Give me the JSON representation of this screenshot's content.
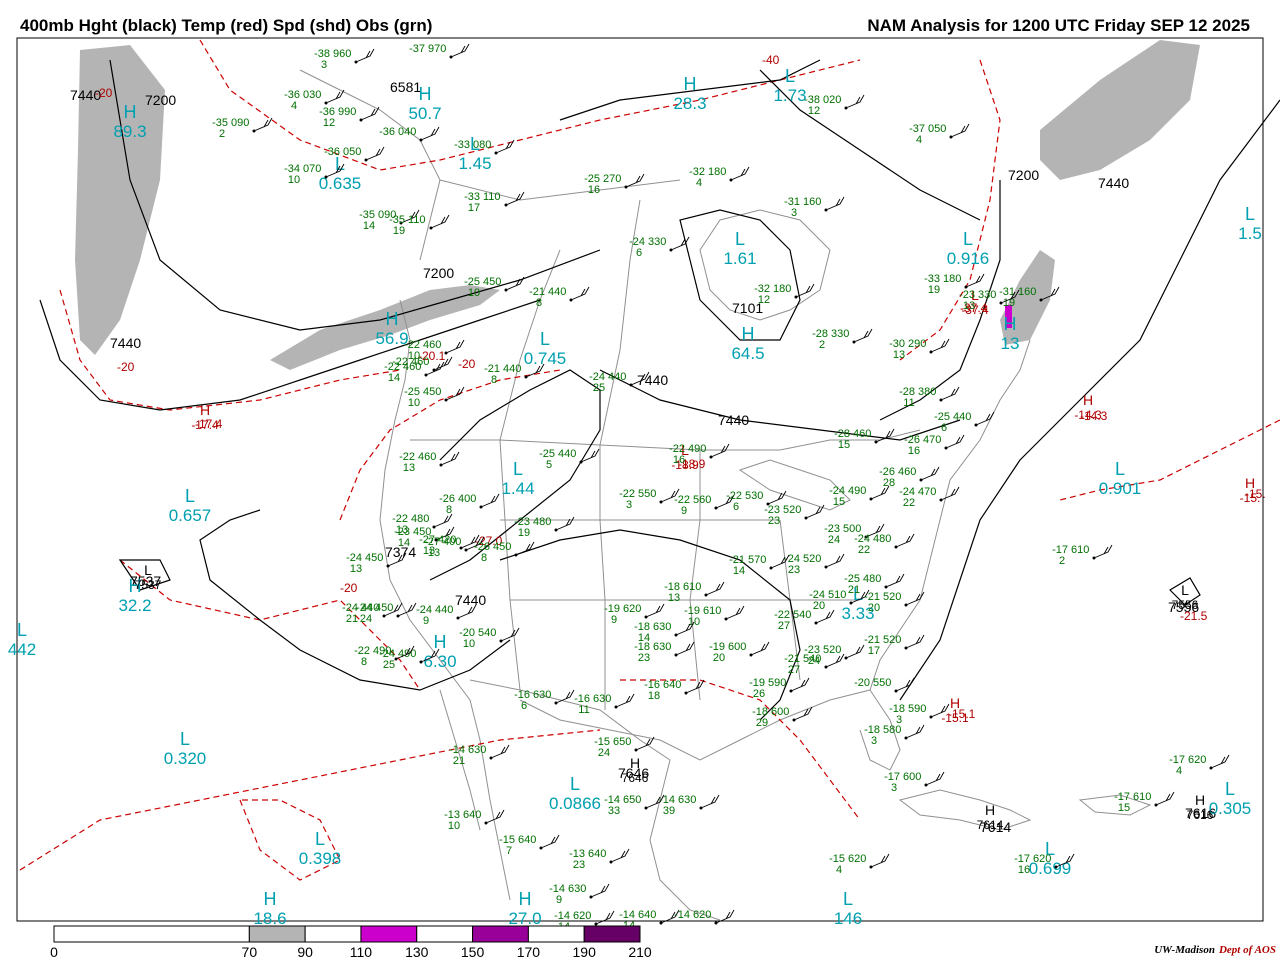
{
  "header": {
    "title_left": "400mb Hght (black) Temp (red) Spd (shd) Obs (grn)",
    "title_right": "NAM Analysis for 1200 UTC Friday  SEP 12 2025"
  },
  "footer": {
    "credit_university": "UW-Madison",
    "credit_dept": "Dept of AOS"
  },
  "colors": {
    "height_contour": "#000000",
    "temp_contour": "#cc0000",
    "obs": "#007000",
    "pressure_centers_low": "#00a0b0",
    "pressure_centers_temp": "#b00000",
    "map_outline": "#808080",
    "speed_70_90": "#b4b4b4",
    "speed_110_130": "#cc00cc",
    "speed_150_170": "#990099",
    "speed_190_210": "#660066"
  },
  "colorbar": {
    "labels": [
      "0",
      "70",
      "90",
      "110",
      "130",
      "150",
      "170",
      "190",
      "210"
    ],
    "bins": [
      {
        "from": 0,
        "to": 70,
        "color": "#ffffff"
      },
      {
        "from": 70,
        "to": 90,
        "color": "#b4b4b4"
      },
      {
        "from": 90,
        "to": 110,
        "color": "#ffffff"
      },
      {
        "from": 110,
        "to": 130,
        "color": "#cc00cc"
      },
      {
        "from": 130,
        "to": 150,
        "color": "#ffffff"
      },
      {
        "from": 150,
        "to": 170,
        "color": "#990099"
      },
      {
        "from": 170,
        "to": 190,
        "color": "#ffffff"
      },
      {
        "from": 190,
        "to": 210,
        "color": "#660066"
      }
    ]
  },
  "height_labels": [
    "7440",
    "7200",
    "7200",
    "7440",
    "7440",
    "7200",
    "7440",
    "7440",
    "7537",
    "7374",
    "7440",
    "6581",
    "7556",
    "7646",
    "7614",
    "7616",
    "7101"
  ],
  "temp_labels": [
    "-20",
    "-40",
    "-20",
    "-20",
    "-20",
    "-17.4",
    "-37.4",
    "-14.3",
    "-15.",
    "-18.9",
    "-15.1",
    "-21.5",
    "-20.1",
    "-27.0"
  ],
  "centers": [
    {
      "letter": "L",
      "value": "0.657",
      "kind": "low"
    },
    {
      "letter": "H",
      "value": "32.2",
      "kind": "low"
    },
    {
      "letter": "L",
      "value": "442",
      "kind": "low"
    },
    {
      "letter": "L",
      "value": "0.320",
      "kind": "low"
    },
    {
      "letter": "L",
      "value": "0.398",
      "kind": "low"
    },
    {
      "letter": "H",
      "value": "18.6",
      "kind": "low"
    },
    {
      "letter": "H",
      "value": "27.0",
      "kind": "low"
    },
    {
      "letter": "L",
      "value": "146",
      "kind": "low"
    },
    {
      "letter": "L",
      "value": "0.0866",
      "kind": "low"
    },
    {
      "letter": "L",
      "value": "1.44",
      "kind": "low"
    },
    {
      "letter": "L",
      "value": "0.745",
      "kind": "low"
    },
    {
      "letter": "H",
      "value": "89.3",
      "kind": "low"
    },
    {
      "letter": "L",
      "value": "0.635",
      "kind": "low"
    },
    {
      "letter": "H",
      "value": "50.7",
      "kind": "low"
    },
    {
      "letter": "L",
      "value": "1.45",
      "kind": "low"
    },
    {
      "letter": "H",
      "value": "28.3",
      "kind": "low"
    },
    {
      "letter": "L",
      "value": "1.73",
      "kind": "low"
    },
    {
      "letter": "L",
      "value": "1.61",
      "kind": "low"
    },
    {
      "letter": "H",
      "value": "64.5",
      "kind": "low"
    },
    {
      "letter": "L",
      "value": "0.916",
      "kind": "low"
    },
    {
      "letter": "L",
      "value": "0.901",
      "kind": "low"
    },
    {
      "letter": "L",
      "value": "0.305",
      "kind": "low"
    },
    {
      "letter": "H",
      "value": "6.30",
      "kind": "low"
    },
    {
      "letter": "L",
      "value": "3.33",
      "kind": "low"
    },
    {
      "letter": "L",
      "value": "0.699",
      "kind": "low"
    },
    {
      "letter": "H",
      "value": "56.9",
      "kind": "low"
    },
    {
      "letter": "H",
      "value": "13",
      "kind": "low"
    },
    {
      "letter": "L",
      "value": "1.5",
      "kind": "low"
    },
    {
      "letter": "H",
      "value": "-17.4",
      "kind": "temp"
    },
    {
      "letter": "L",
      "value": "-37.4",
      "kind": "temp"
    },
    {
      "letter": "H",
      "value": "-14.3",
      "kind": "temp"
    },
    {
      "letter": "H",
      "value": "-15.",
      "kind": "temp"
    },
    {
      "letter": "H",
      "value": "-15.1",
      "kind": "temp"
    },
    {
      "letter": "L",
      "value": "-18.9",
      "kind": "temp"
    },
    {
      "letter": "H",
      "value": "7646",
      "kind": "height"
    },
    {
      "letter": "H",
      "value": "7614",
      "kind": "height"
    },
    {
      "letter": "H",
      "value": "7616",
      "kind": "height"
    },
    {
      "letter": "L",
      "value": "7537",
      "kind": "height"
    },
    {
      "letter": "L",
      "value": "7556",
      "kind": "height"
    }
  ],
  "observations": [
    {
      "t": "-38",
      "h": "960",
      "d": "3"
    },
    {
      "t": "-37",
      "h": "970",
      "d": ""
    },
    {
      "t": "-36",
      "h": "030",
      "d": "4"
    },
    {
      "t": "-35",
      "h": "090",
      "d": "2"
    },
    {
      "t": "-36",
      "h": "990",
      "d": "12"
    },
    {
      "t": "-36",
      "h": "040",
      "d": ""
    },
    {
      "t": "-36",
      "h": "050",
      "d": ""
    },
    {
      "t": "-34",
      "h": "070",
      "d": "10"
    },
    {
      "t": "-33",
      "h": "080",
      "d": ""
    },
    {
      "t": "-33",
      "h": "110",
      "d": "17"
    },
    {
      "t": "-35",
      "h": "090",
      "d": "14"
    },
    {
      "t": "-35",
      "h": "110",
      "d": "19"
    },
    {
      "t": "-25",
      "h": "270",
      "d": "16"
    },
    {
      "t": "-32",
      "h": "180",
      "d": "4"
    },
    {
      "t": "-31",
      "h": "160",
      "d": "3"
    },
    {
      "t": "-38",
      "h": "020",
      "d": "12"
    },
    {
      "t": "-37",
      "h": "050",
      "d": "4"
    },
    {
      "t": "-24",
      "h": "330",
      "d": "6"
    },
    {
      "t": "-32",
      "h": "180",
      "d": "12"
    },
    {
      "t": "-31",
      "h": "160",
      "d": "19"
    },
    {
      "t": "-33",
      "h": "180",
      "d": "19"
    },
    {
      "t": "-23",
      "h": "330",
      "d": "13"
    },
    {
      "t": "-28",
      "h": "330",
      "d": "2"
    },
    {
      "t": "-30",
      "h": "290",
      "d": "13"
    },
    {
      "t": "-28",
      "h": "380",
      "d": "11"
    },
    {
      "t": "-25",
      "h": "440",
      "d": "6"
    },
    {
      "t": "-28",
      "h": "460",
      "d": "15"
    },
    {
      "t": "-26",
      "h": "470",
      "d": "16"
    },
    {
      "t": "-26",
      "h": "460",
      "d": "28"
    },
    {
      "t": "-24",
      "h": "470",
      "d": "22"
    },
    {
      "t": "-24",
      "h": "490",
      "d": "15"
    },
    {
      "t": "-23",
      "h": "500",
      "d": "24"
    },
    {
      "t": "-24",
      "h": "480",
      "d": "22"
    },
    {
      "t": "-25",
      "h": "480",
      "d": "21"
    },
    {
      "t": "-24",
      "h": "510",
      "d": "20"
    },
    {
      "t": "-21",
      "h": "520",
      "d": "20"
    },
    {
      "t": "-21",
      "h": "520",
      "d": "17"
    },
    {
      "t": "-23",
      "h": "520",
      "d": "24"
    },
    {
      "t": "-24",
      "h": "520",
      "d": "23"
    },
    {
      "t": "-20",
      "h": "550",
      "d": ""
    },
    {
      "t": "-18",
      "h": "590",
      "d": "3"
    },
    {
      "t": "-18",
      "h": "580",
      "d": "3"
    },
    {
      "t": "-17",
      "h": "600",
      "d": "3"
    },
    {
      "t": "-17",
      "h": "610",
      "d": "2"
    },
    {
      "t": "-17",
      "h": "620",
      "d": "4"
    },
    {
      "t": "-17",
      "h": "610",
      "d": "15"
    },
    {
      "t": "-17",
      "h": "620",
      "d": "16"
    },
    {
      "t": "-15",
      "h": "620",
      "d": "4"
    },
    {
      "t": "-21",
      "h": "440",
      "d": "8"
    },
    {
      "t": "-22",
      "h": "460",
      "d": "10"
    },
    {
      "t": "-22",
      "h": "460",
      "d": "14"
    },
    {
      "t": "-22",
      "h": "460",
      "d": "13"
    },
    {
      "t": "-23",
      "h": "450",
      "d": "14"
    },
    {
      "t": "-24",
      "h": "440",
      "d": "25"
    },
    {
      "t": "-25",
      "h": "450",
      "d": "10"
    },
    {
      "t": "-25",
      "h": "440",
      "d": "5"
    },
    {
      "t": "-24",
      "h": "450",
      "d": "13"
    },
    {
      "t": "-24",
      "h": "490",
      "d": "25"
    },
    {
      "t": "-22",
      "h": "480",
      "d": "13"
    },
    {
      "t": "-26",
      "h": "400",
      "d": "8"
    },
    {
      "t": "-27",
      "h": "400",
      "d": "13"
    },
    {
      "t": "-23",
      "h": "480",
      "d": "19"
    },
    {
      "t": "-24",
      "h": "440",
      "d": "21"
    },
    {
      "t": "-27",
      "h": "420",
      "d": "13"
    },
    {
      "t": "-26",
      "h": "450",
      "d": "8"
    },
    {
      "t": "-24",
      "h": "450",
      "d": "24"
    },
    {
      "t": "-24",
      "h": "440",
      "d": "9"
    },
    {
      "t": "-20",
      "h": "540",
      "d": "10"
    },
    {
      "t": "-22",
      "h": "490",
      "d": "8"
    },
    {
      "t": "-22",
      "h": "490",
      "d": "16"
    },
    {
      "t": "-22",
      "h": "550",
      "d": "3"
    },
    {
      "t": "-22",
      "h": "560",
      "d": "9"
    },
    {
      "t": "-22",
      "h": "530",
      "d": "6"
    },
    {
      "t": "-23",
      "h": "520",
      "d": "23"
    },
    {
      "t": "-21",
      "h": "570",
      "d": "14"
    },
    {
      "t": "-22",
      "h": "540",
      "d": "27"
    },
    {
      "t": "-21",
      "h": "540",
      "d": "27"
    },
    {
      "t": "-19",
      "h": "620",
      "d": "9"
    },
    {
      "t": "-18",
      "h": "610",
      "d": "13"
    },
    {
      "t": "-19",
      "h": "610",
      "d": "10"
    },
    {
      "t": "-18",
      "h": "630",
      "d": "14"
    },
    {
      "t": "-19",
      "h": "600",
      "d": "20"
    },
    {
      "t": "-19",
      "h": "590",
      "d": "26"
    },
    {
      "t": "-18",
      "h": "600",
      "d": "29"
    },
    {
      "t": "-18",
      "h": "630",
      "d": "23"
    },
    {
      "t": "-16",
      "h": "640",
      "d": "18"
    },
    {
      "t": "-16",
      "h": "630",
      "d": "6"
    },
    {
      "t": "-16",
      "h": "630",
      "d": "11"
    },
    {
      "t": "-15",
      "h": "650",
      "d": "24"
    },
    {
      "t": "-14",
      "h": "630",
      "d": "21"
    },
    {
      "t": "-14",
      "h": "650",
      "d": "33"
    },
    {
      "t": "-14",
      "h": "630",
      "d": "39"
    },
    {
      "t": "-13",
      "h": "640",
      "d": "10"
    },
    {
      "t": "-15",
      "h": "640",
      "d": "7"
    },
    {
      "t": "-13",
      "h": "640",
      "d": "23"
    },
    {
      "t": "-14",
      "h": "630",
      "d": "9"
    },
    {
      "t": "-14",
      "h": "620",
      "d": "14"
    },
    {
      "t": "-14",
      "h": "640",
      "d": "14"
    },
    {
      "t": "-14",
      "h": "620",
      "d": ""
    },
    {
      "t": "-21",
      "h": "440",
      "d": "8"
    },
    {
      "t": "-22",
      "h": "460",
      "d": ""
    },
    {
      "t": "-25",
      "h": "450",
      "d": "10"
    }
  ]
}
